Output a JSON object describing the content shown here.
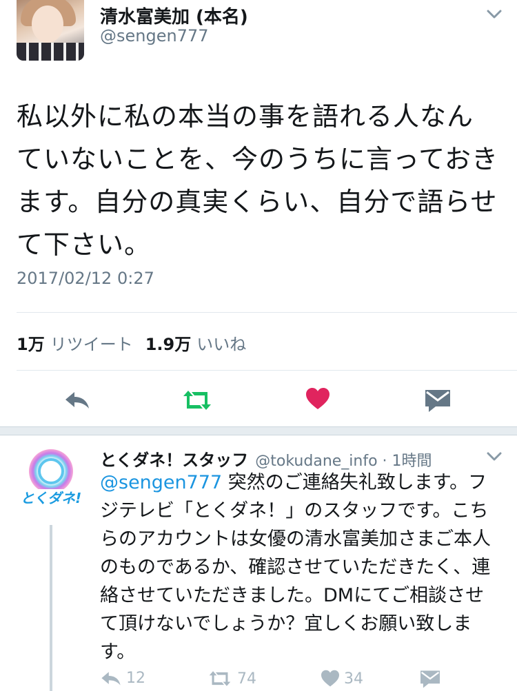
{
  "main_tweet": {
    "display_name": "清水富美加 (本名)",
    "handle": "@sengen777",
    "text": "私以外に私の本当の事を語れる人なんていないことを、今のうちに言っておきます。自分の真実くらい、自分で語らせて下さい。",
    "timestamp": "2017/02/12 0:27",
    "retweet_count": "1万",
    "retweet_label": "リツイート",
    "like_count": "1.9万",
    "like_label": "いいね",
    "colors": {
      "retweet": "#17bf63",
      "like": "#e0245e",
      "icon": "#657786"
    }
  },
  "reply_tweet": {
    "display_name": "とくダネ！スタッフ",
    "handle_time": "@tokudane_info · 1時間",
    "mention": "@sengen777",
    "text": " 突然のご連絡失礼致します。フジテレビ「とくダネ！」のスタッフです。こちらのアカウントは女優の清水富美加さまご本人のものであるか、確認させていただきたく、連絡させていただきました。DMにてご相談させて頂けないでしょうか？宜しくお願い致します。",
    "reply_count": "12",
    "retweet_count": "74",
    "like_count": "34",
    "avatar_logo_text": "とくダネ!",
    "colors": {
      "mention": "#1b95e0",
      "action": "#aab8c2"
    }
  }
}
